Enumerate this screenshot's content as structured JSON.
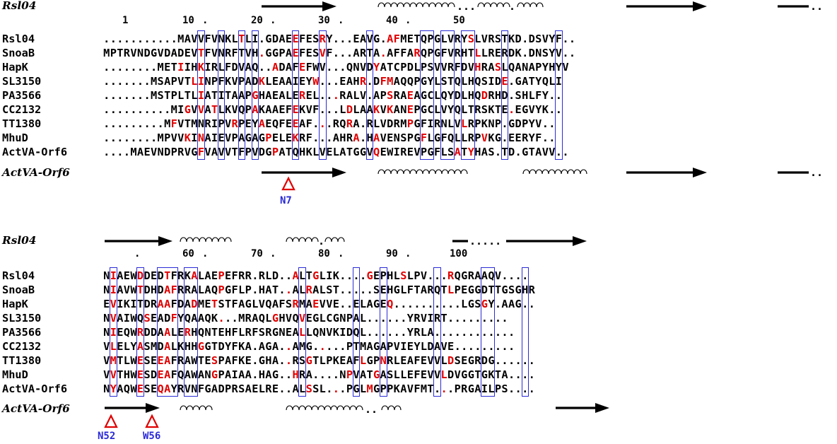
{
  "top_block": {
    "structure_label": "Rsl04",
    "names": [
      "Rsl04",
      "SnoaB",
      "HapK",
      "SL3150",
      "PA3566",
      "CC2132",
      "TT1380",
      "MhuD",
      "ActVA-Orf6"
    ],
    "sequences": [
      "...........MAVVFVNKLTLI.GDAEEFESRY...EAVG.AFMETQPGLVRYSLVRSTKD.DSVYF..",
      "MPTRVNDGVDADEVTFVNRFTVH.GGPAEFESVF...ARTA.AFFARQPGFVRHTLLRERDK.DNSYV..",
      "........METIIHKIRLFDVAQ..ADAFEFWV...QNVDYATCPDLPSVVRFDVHRASLQANAPYHYV",
      ".......MSAPVTLINPFKVPADKLEAAIEYW...EAHR.DFMAQQPGYLSTQLHQSIDE.GATYQLI",
      ".......MSTPLTLIATITAAPGHAEALEREL...RALV.APSRAEAGCLQYDLHQDRHD.SHLFY..",
      "..........MIGVVATLKVQPAKAAEFEKVF...LDLAAKVKANEPGCLVYQLTRSKTE.EGVYK..",
      ".........MFVTMNRIPVRPEYAEQFEEAF...RQRA.RLVDRMPGFIRNLVLRPKNP.GDPYV..",
      "........MPVVKINAIEVPAGAGPELEKRF...AHRA.HAVENSPGFLGFQLLRPVKG.EERYF..",
      "....MAEVNDPRVGFVAVVTFPVDGPATQHKLVELATGGVQEWIREVPGFLSATYHAS.TD.GTAVV.."
    ],
    "ruler": [
      "1",
      "10",
      "20",
      "30",
      "40",
      "50"
    ],
    "bottom_structure_label": "ActVA-Orf6",
    "markers": [
      "N7"
    ]
  },
  "bottom_block": {
    "structure_label": "Rsl04",
    "names": [
      "Rsl04",
      "SnoaB",
      "HapK",
      "SL3150",
      "PA3566",
      "CC2132",
      "TT1380",
      "MhuD",
      "ActVA-Orf6"
    ],
    "sequences": [
      "NIAEWDDEDTFRKALAEPEFRR.RLD..ALTGLIK....GEPHLSLPV...RQGRAAQV....",
      "NIAVWTDHDAFRRALAQPGFLP.HAT..ALRALST.....SEHGLFTARQTLPEGGDTTGSGHR",
      "EVIKITDRAAFDADMETSTFAGLVQAFSRMAEVVE..ELAGEQ..........LGSGY.AAG..",
      "NVAIWQSEADFYQAAQK...MRAQLGHVQVEGLCGNPAL......YRVIRT.........",
      "NIEQWRDDAALERHQNTEHFLRFSRGNEALLQNVKIDQL......YRLA............",
      "VLELYASMDALKHHGGTDYFKA.AGA..AMG.....PTMAGAPVIEYLDAVE.........",
      "VMTLWESEEAFRAWTESPAFKE.GHA..RSGTLPKEAFLGPNRLEAFEVVLDSEGRDG......",
      "VVTHWESDEAFQAWANGPAIAA.HAG..HRA....NPVATGASLLEFEVVLDVGGTGKTA....",
      "NYAQWESEQAYRVNFGADPRSAELRE..ALSSL...PGLMGPPKAVFMT...PRGAILPS...."
    ],
    "ruler": [
      "60",
      "70",
      "80",
      "90",
      "100"
    ],
    "bottom_structure_label": "ActVA-Orf6",
    "markers": [
      "N52",
      "W56"
    ]
  },
  "colors": {
    "identical_residue": "#e00000",
    "similarity_box": "#2b2bd6",
    "marker": "#e00000",
    "marker_label": "#2a2ad8"
  }
}
